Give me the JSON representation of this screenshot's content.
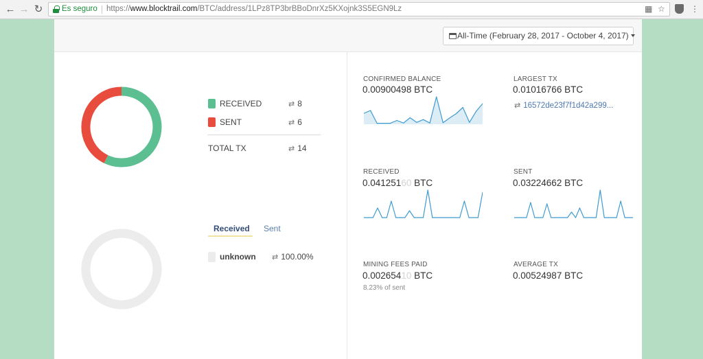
{
  "browser": {
    "secure_label": "Es seguro",
    "url_scheme": "https://",
    "url_host": "www.blocktrail.com",
    "url_path": "/BTC/address/1LPz8TP3brBBoDnrXz5KXojnk3S5EGN9Lz"
  },
  "header": {
    "range_label": "All-Time (February 28, 2017 - October 4, 2017)"
  },
  "tx_summary": {
    "received_label": "RECEIVED",
    "received_count": "8",
    "sent_label": "SENT",
    "sent_count": "6",
    "total_label": "TOTAL TX",
    "total_count": "14",
    "received_color": "#5cbf92",
    "sent_color": "#e74c3c"
  },
  "tabs": {
    "received": "Received",
    "sent": "Sent"
  },
  "breakdown": {
    "label": "unknown",
    "percent": "100.00%",
    "fraction": 1.0
  },
  "stats": {
    "confirmed_balance": {
      "label": "CONFIRMED BALANCE",
      "value": "0.00900498 BTC"
    },
    "largest_tx": {
      "label": "LARGEST TX",
      "value": "0.01016766 BTC",
      "tx": "16572de23f7f1d42a299..."
    },
    "received": {
      "label": "RECEIVED",
      "value_main": "0.041251",
      "value_faded": "60",
      "unit": " BTC"
    },
    "sent": {
      "label": "SENT",
      "value": "0.03224662 BTC"
    },
    "mining_fees": {
      "label": "MINING FEES PAID",
      "value_main": "0.002654",
      "value_faded": "10",
      "unit": " BTC",
      "sub": "8.23% of sent"
    },
    "average_tx": {
      "label": "AVERAGE TX",
      "value": "0.00524987 BTC"
    }
  },
  "chart_data": [
    {
      "type": "pie",
      "categories": [
        "RECEIVED",
        "SENT"
      ],
      "values": [
        8,
        6
      ],
      "colors": [
        "#5cbf92",
        "#e74c3c"
      ]
    },
    {
      "type": "pie",
      "categories": [
        "unknown"
      ],
      "values": [
        100
      ],
      "colors": [
        "#ececec"
      ]
    },
    {
      "type": "area",
      "values": [
        0.0035,
        0.0044,
        0.0003,
        0.0003,
        0.0003,
        0.0012,
        0.0004,
        0.0021,
        0.0006,
        0.0015,
        0.0004,
        0.0088,
        0.0005,
        0.002,
        0.0034,
        0.0054,
        0.0006,
        0.0041,
        0.0066
      ],
      "color": "#3f9bd0"
    },
    {
      "type": "line",
      "values": [
        0,
        0,
        0,
        0.35,
        0,
        0,
        0.6,
        0,
        0,
        0,
        0.25,
        0,
        0,
        0,
        1.0,
        0,
        0,
        0,
        0,
        0,
        0,
        0,
        0.6,
        0,
        0,
        0,
        0.92
      ],
      "color": "#3f9bd0"
    },
    {
      "type": "line",
      "values": [
        0,
        0,
        0,
        0,
        0.55,
        0,
        0,
        0,
        0.5,
        0,
        0,
        0,
        0,
        0,
        0.2,
        0,
        0.35,
        0,
        0,
        0,
        0,
        1.0,
        0,
        0,
        0,
        0,
        0.6,
        0,
        0,
        0
      ],
      "color": "#3f9bd0"
    }
  ]
}
